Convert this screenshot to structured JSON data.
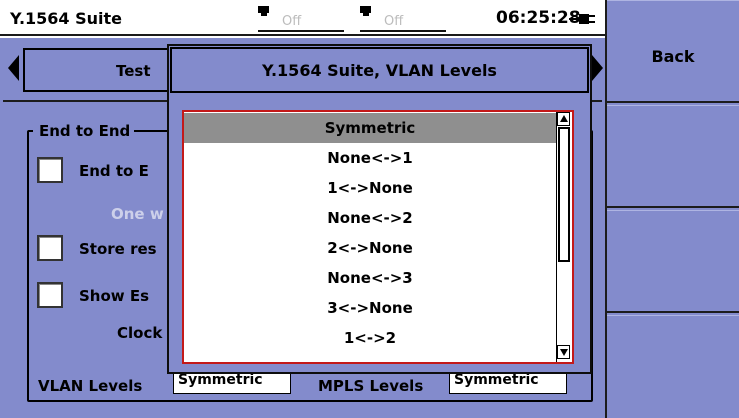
{
  "status": {
    "app_title": "Y.1564 Suite",
    "port1_state": "Off",
    "port2_state": "Off",
    "clock": "06:25:28"
  },
  "side_buttons": {
    "back_label": "Back"
  },
  "tab": {
    "label": "Test"
  },
  "background": {
    "group_title": "End to End",
    "end_to_end_label": "End to E",
    "one_way_label": "One w",
    "store_results_label": "Store res",
    "show_es_label": "Show Es",
    "clock_label": "Clock",
    "vlan_levels_label": "VLAN Levels",
    "vlan_levels_value": "Symmetric",
    "mpls_levels_label": "MPLS Levels",
    "mpls_levels_value": "Symmetric"
  },
  "dialog": {
    "title": "Y.1564 Suite, VLAN Levels",
    "options": [
      "Symmetric",
      "None<->1",
      "1<->None",
      "None<->2",
      "2<->None",
      "None<->3",
      "3<->None",
      "1<->2"
    ],
    "selected_index": 0
  },
  "colors": {
    "panel": "#838bcc",
    "selection": "#8f8f8f",
    "list_border": "#c31919"
  },
  "icons": [
    "ethernet-port-icon",
    "battery-plug-icon",
    "left-arrow-icon",
    "right-arrow-icon",
    "scroll-up-icon",
    "scroll-down-icon"
  ]
}
